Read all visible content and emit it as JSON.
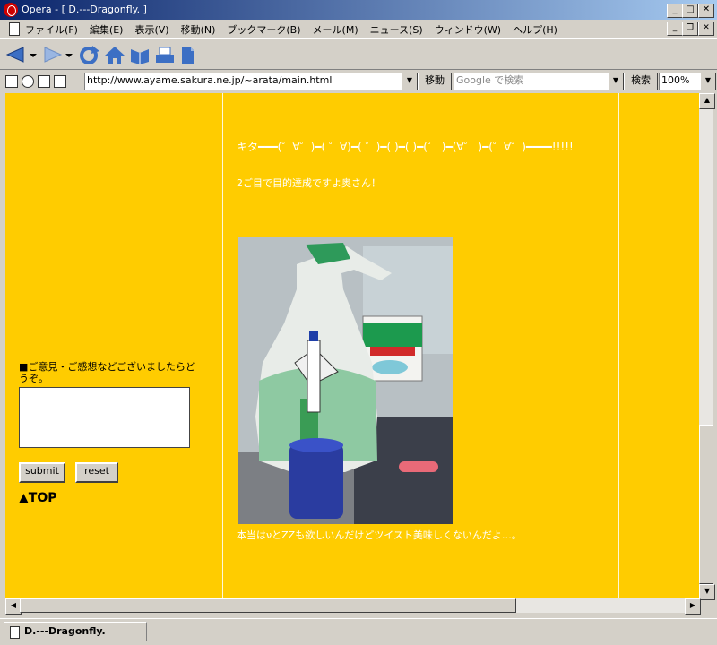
{
  "window": {
    "title": "Opera - [ D.---Dragonfly. ]"
  },
  "menu": [
    "ファイル(F)",
    "編集(E)",
    "表示(V)",
    "移動(N)",
    "ブックマーク(B)",
    "メール(M)",
    "ニュース(S)",
    "ウィンドウ(W)",
    "ヘルプ(H)"
  ],
  "address": {
    "url": "http://www.ayame.sakura.ne.jp/~arata/main.html",
    "go_label": "移動",
    "search_placeholder": "Google で検索",
    "search_label": "検索",
    "zoom": "100%"
  },
  "page": {
    "kita": "キタ━━━(゜∀゜)━( ゜∀)━(  ゜)━(  )━(  )━(゜  )━(∀゜ )━(゜∀゜)━━━━!!!!!",
    "sub": "2ご目で目的達成ですよ奥さん！",
    "caption": "本当はνとZZも欲しいんだけどツイスト美味しくないんだよ…。",
    "form_label": "■ご意見・ご感想などございましたらどうぞ。",
    "submit_label": "submit",
    "reset_label": "reset",
    "top_link": "▲TOP"
  },
  "status": {
    "tab_title": "D.---Dragonfly."
  },
  "colors": {
    "page_bg": "#ffcc00",
    "title_bar": "#0a246a",
    "text_white": "#ffffff"
  }
}
